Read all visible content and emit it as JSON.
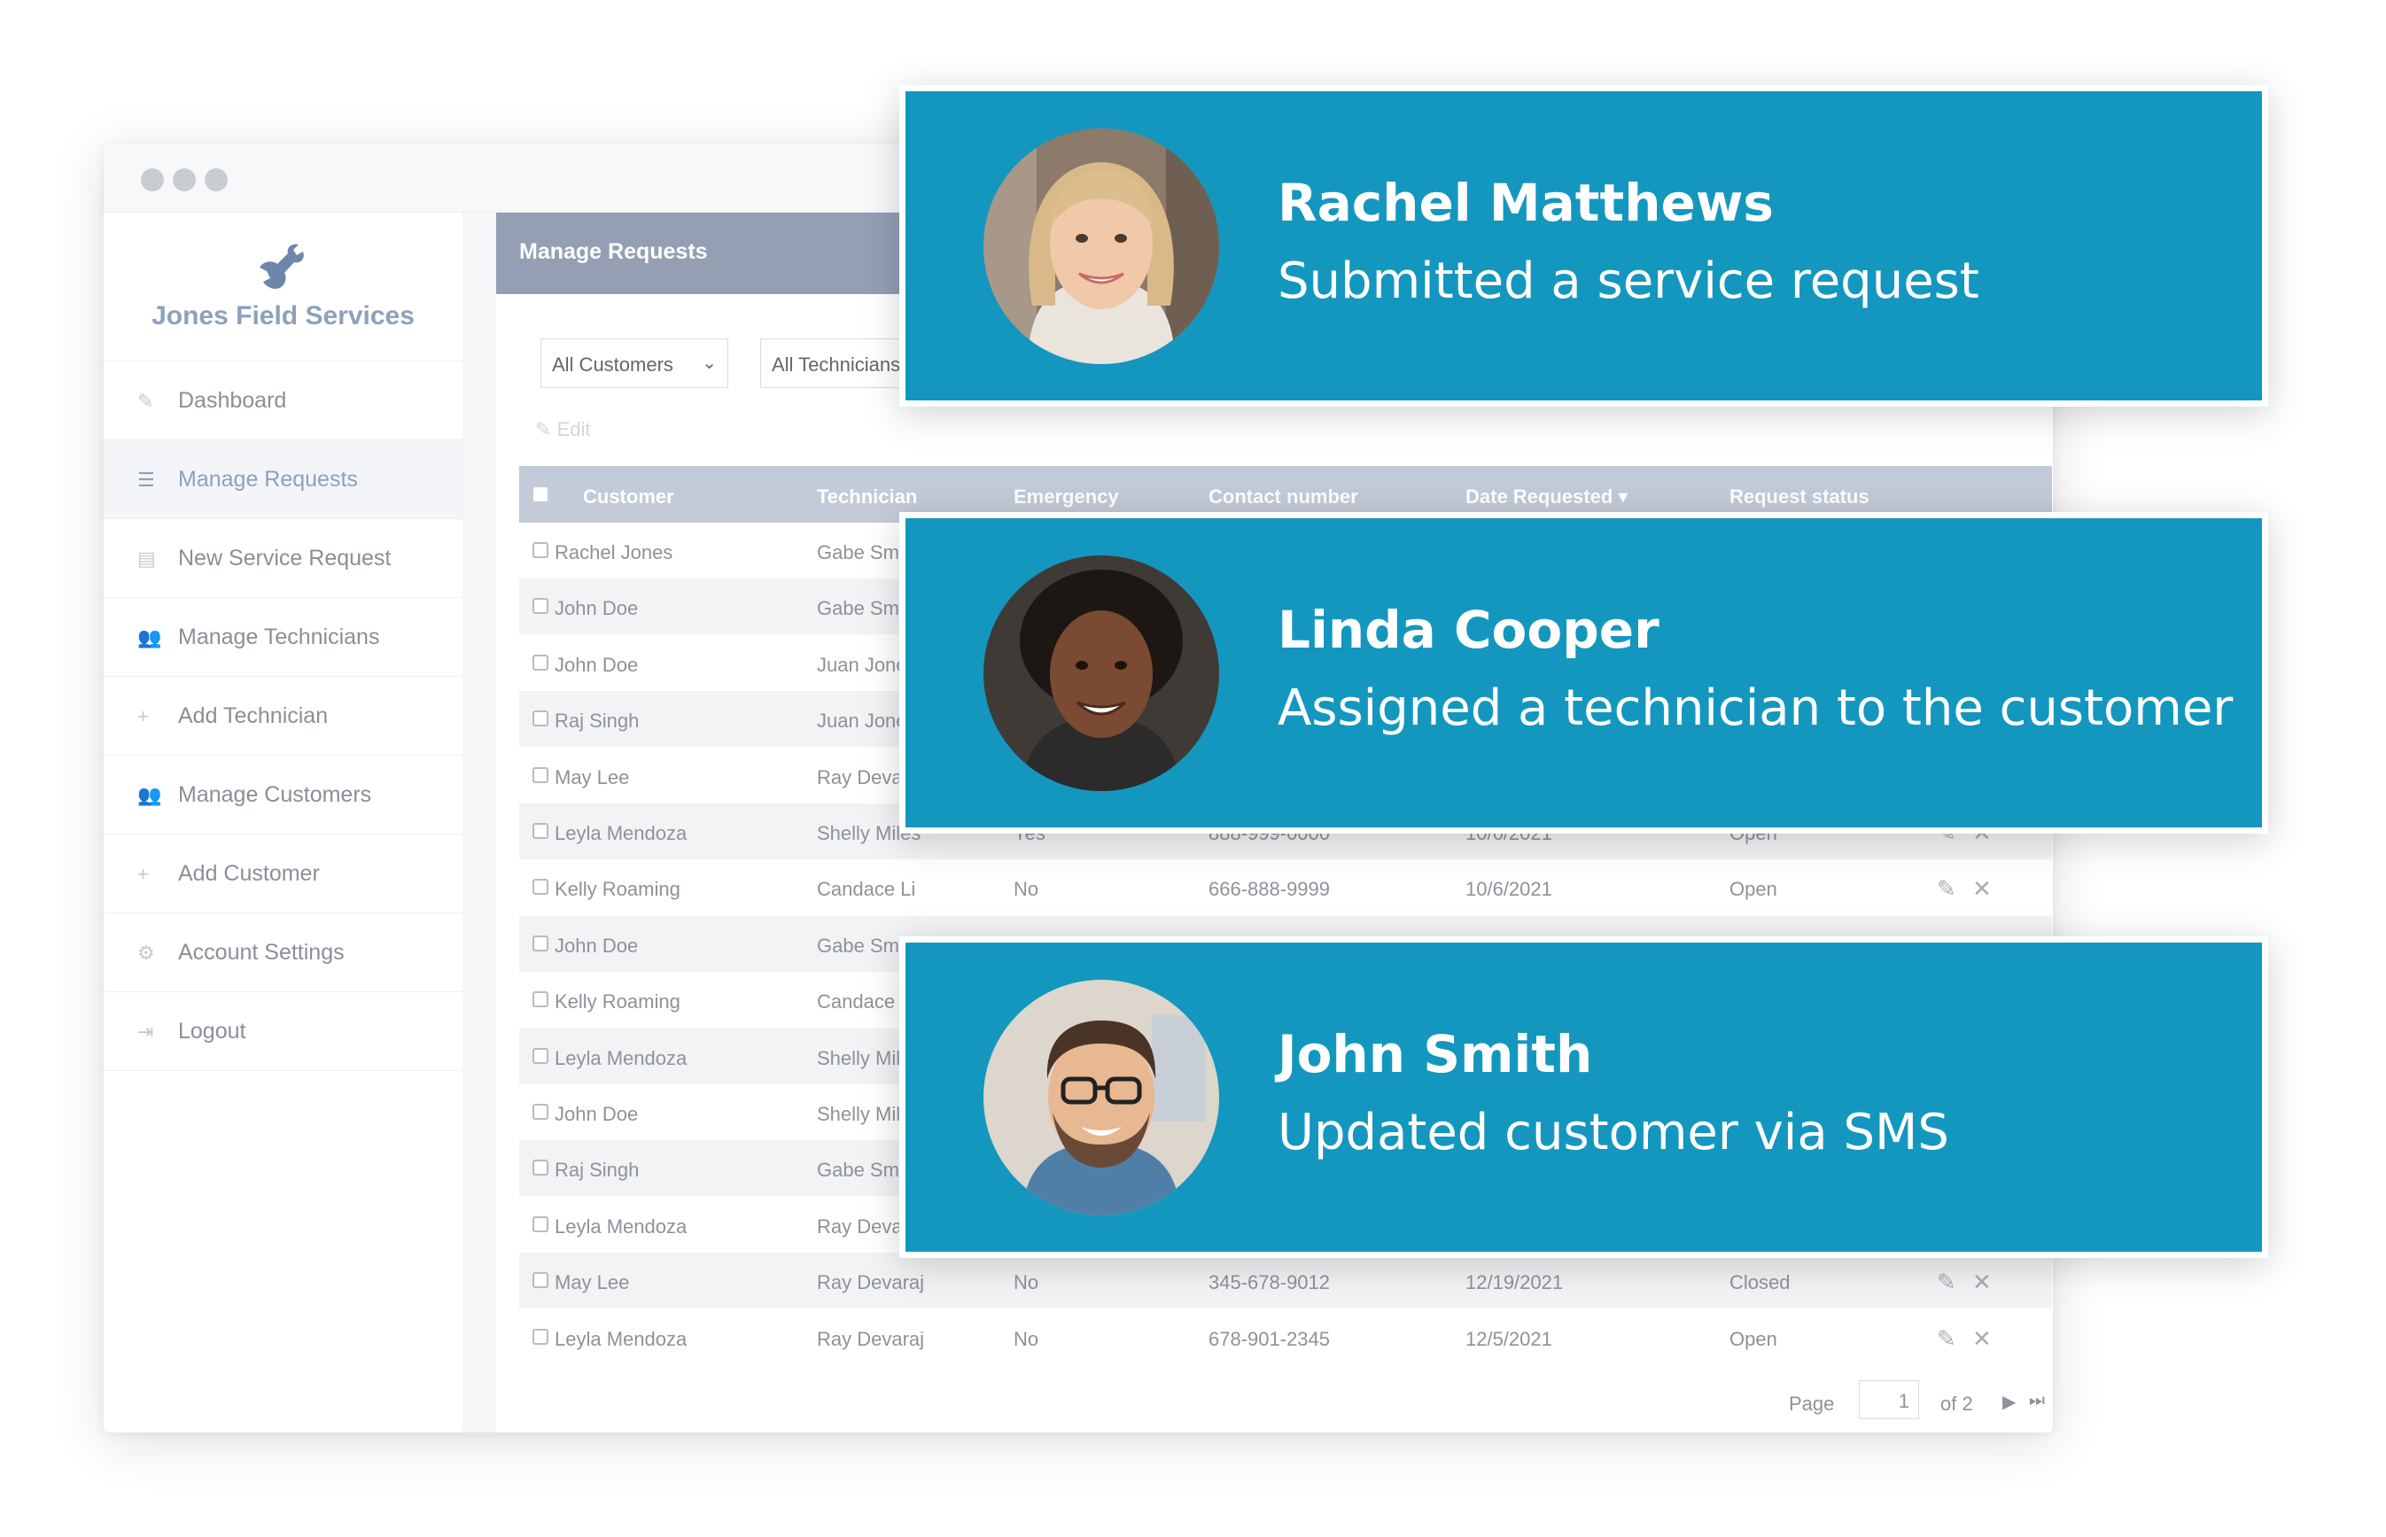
{
  "app": {
    "brand": "Jones Field Services",
    "page_title": "Manage Requests"
  },
  "sidebar": {
    "items": [
      {
        "label": "Dashboard",
        "icon": "pencil-icon"
      },
      {
        "label": "Manage Requests",
        "icon": "list-icon",
        "active": true
      },
      {
        "label": "New Service Request",
        "icon": "document-icon"
      },
      {
        "label": "Manage Technicians",
        "icon": "users-icon"
      },
      {
        "label": "Add Technician",
        "icon": "user-plus-icon"
      },
      {
        "label": "Manage Customers",
        "icon": "users-icon"
      },
      {
        "label": "Add Customer",
        "icon": "user-plus-icon"
      },
      {
        "label": "Account Settings",
        "icon": "gear-icon"
      },
      {
        "label": "Logout",
        "icon": "logout-icon"
      }
    ]
  },
  "filters": {
    "customers": "All Customers",
    "technicians": "All Technicians"
  },
  "toolbar": {
    "edit_label": "Edit"
  },
  "table": {
    "columns": [
      "Customer",
      "Technician",
      "Emergency",
      "Contact number",
      "Date Requested",
      "Request status"
    ],
    "sort_indicator": "▾",
    "rows": [
      {
        "customer": "Rachel Jones",
        "technician": "Gabe Smith",
        "emergency": "",
        "contact": "",
        "date": "",
        "status": ""
      },
      {
        "customer": "John Doe",
        "technician": "Gabe Smith",
        "emergency": "",
        "contact": "",
        "date": "",
        "status": ""
      },
      {
        "customer": "John Doe",
        "technician": "Juan Jones",
        "emergency": "",
        "contact": "",
        "date": "",
        "status": ""
      },
      {
        "customer": "Raj Singh",
        "technician": "Juan Jones",
        "emergency": "",
        "contact": "",
        "date": "",
        "status": ""
      },
      {
        "customer": "May Lee",
        "technician": "Ray Devaraj",
        "emergency": "",
        "contact": "",
        "date": "",
        "status": ""
      },
      {
        "customer": "Leyla Mendoza",
        "technician": "Shelly Miles",
        "emergency": "Yes",
        "contact": "888-999-0000",
        "date": "10/6/2021",
        "status": "Open"
      },
      {
        "customer": "Kelly Roaming",
        "technician": "Candace Li",
        "emergency": "No",
        "contact": "666-888-9999",
        "date": "10/6/2021",
        "status": "Open"
      },
      {
        "customer": "John Doe",
        "technician": "Gabe Smith",
        "emergency": "",
        "contact": "",
        "date": "",
        "status": ""
      },
      {
        "customer": "Kelly Roaming",
        "technician": "Candace Li",
        "emergency": "",
        "contact": "",
        "date": "",
        "status": ""
      },
      {
        "customer": "Leyla Mendoza",
        "technician": "Shelly Miles",
        "emergency": "",
        "contact": "",
        "date": "",
        "status": ""
      },
      {
        "customer": "John Doe",
        "technician": "Shelly Miles",
        "emergency": "",
        "contact": "",
        "date": "",
        "status": ""
      },
      {
        "customer": "Raj Singh",
        "technician": "Gabe Smith",
        "emergency": "",
        "contact": "",
        "date": "",
        "status": ""
      },
      {
        "customer": "Leyla Mendoza",
        "technician": "Ray Devaraj",
        "emergency": "",
        "contact": "",
        "date": "",
        "status": ""
      },
      {
        "customer": "May Lee",
        "technician": "Ray Devaraj",
        "emergency": "No",
        "contact": "345-678-9012",
        "date": "12/19/2021",
        "status": "Closed"
      },
      {
        "customer": "Leyla Mendoza",
        "technician": "Ray Devaraj",
        "emergency": "No",
        "contact": "678-901-2345",
        "date": "12/5/2021",
        "status": "Open"
      }
    ]
  },
  "pagination": {
    "page_label": "Page",
    "current": "1",
    "of_label": "of 2"
  },
  "notifications": [
    {
      "name": "Rachel Matthews",
      "message": "Submitted a service request"
    },
    {
      "name": "Linda Cooper",
      "message": "Assigned a technician to the customer"
    },
    {
      "name": "John Smith",
      "message": "Updated customer via SMS"
    }
  ],
  "colors": {
    "card": "#1497bf",
    "header": "#949fb4",
    "table_head": "#c3cad8",
    "brand": "#8ea0bd"
  }
}
